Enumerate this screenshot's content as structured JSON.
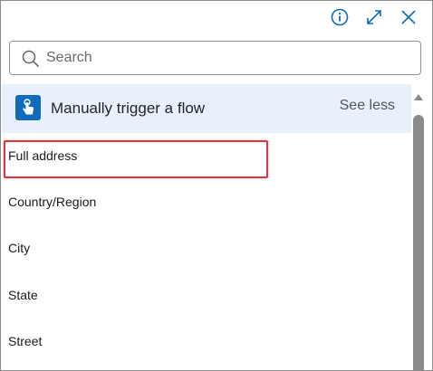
{
  "toolbar": {
    "icons": [
      "info-icon",
      "expand-icon",
      "close-icon"
    ]
  },
  "search": {
    "placeholder": "Search",
    "value": ""
  },
  "trigger": {
    "title": "Manually trigger a flow",
    "toggle_label": "See less",
    "icon": "touch-hand-icon"
  },
  "items": [
    {
      "label": "Full address"
    },
    {
      "label": "Country/Region"
    },
    {
      "label": "City"
    },
    {
      "label": "State"
    },
    {
      "label": "Street"
    }
  ],
  "colors": {
    "accent": "#0f6cbd",
    "header_bg": "#e8f1fb",
    "highlight": "#d9363e"
  }
}
